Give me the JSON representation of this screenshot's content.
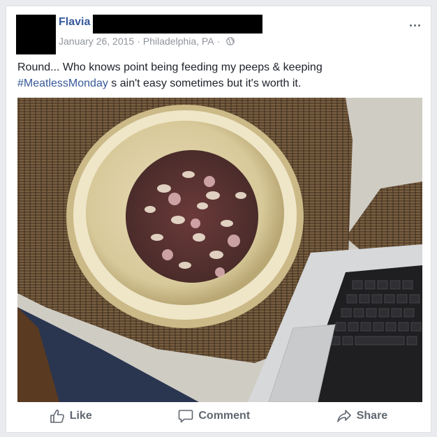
{
  "post": {
    "author": "Flavia",
    "date": "January 26, 2015",
    "location": "Philadelphia, PA",
    "separator": "·",
    "text_before": "Round... Who knows point being feeding my peeps & keeping ",
    "hashtag": "#MeatlessMonday",
    "text_after": " s ain't easy sometimes but it's worth it."
  },
  "actions": {
    "like_label": "Like",
    "comment_label": "Comment",
    "share_label": "Share"
  },
  "icons": {
    "more": "more-options-icon",
    "privacy": "globe-icon",
    "like": "thumbs-up-icon",
    "comment": "speech-bubble-icon",
    "share": "share-arrow-icon"
  },
  "colors": {
    "link": "#365899",
    "meta": "#90949c",
    "action": "#606770"
  }
}
